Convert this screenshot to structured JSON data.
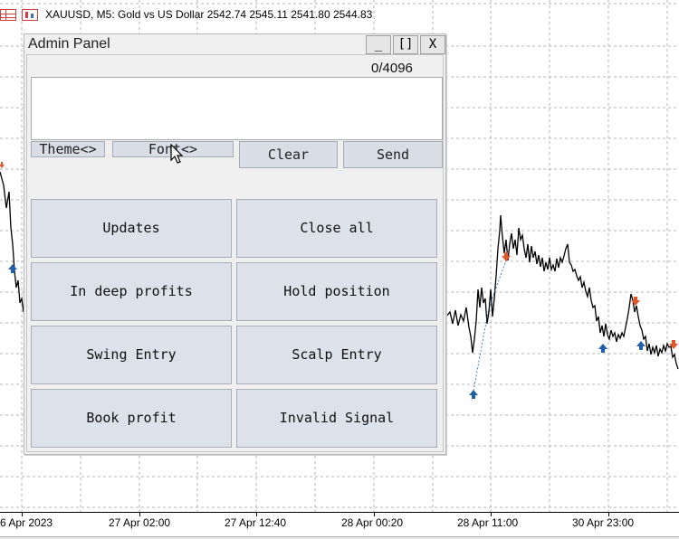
{
  "chart": {
    "header": {
      "symbol_line": "XAUUSD, M5:  Gold vs US Dollar  2542.74 2545.11 2541.80 2544.83",
      "icons": [
        "grid-table-icon",
        "candle-bars-icon"
      ]
    },
    "time_axis": {
      "labels": [
        "6 Apr 2023",
        "27 Apr 02:00",
        "27 Apr 12:40",
        "28 Apr 00:20",
        "28 Apr 11:00",
        "30 Apr 23:00"
      ]
    },
    "colors": {
      "price_line": "#000000",
      "up_arrow": "#1f5fa8",
      "down_arrow": "#e0562a",
      "grid": "#b4b4b4"
    }
  },
  "panel": {
    "title": "Admin Panel",
    "window_buttons": {
      "minimize": "_",
      "maximize": "[]",
      "close": "X"
    },
    "char_counter": "0/4096",
    "message_placeholder": "",
    "toolbar": {
      "theme": "Theme<>",
      "font": "Font<>",
      "clear": "Clear",
      "send": "Send"
    },
    "quick_messages": [
      "Updates",
      "Close all",
      "In deep profits",
      "Hold position",
      "Swing Entry",
      "Scalp Entry",
      "Book profit",
      "Invalid Signal"
    ],
    "colors": {
      "button_bg": "#dce1ea",
      "panel_bg": "#f0f0f0"
    }
  }
}
